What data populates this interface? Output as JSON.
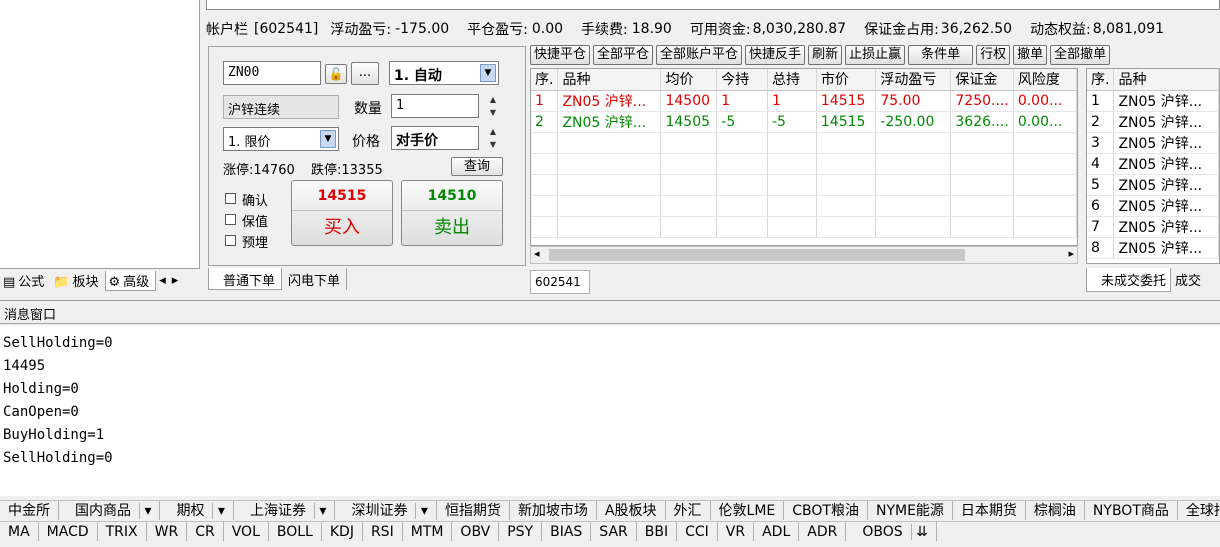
{
  "left_tabs": [
    "公式",
    "板块",
    "高级"
  ],
  "account_bar": {
    "label": "帐户栏",
    "account": "[602541]",
    "floating_pl_label": "浮动盈亏:",
    "floating_pl": "-175.00",
    "close_pl_label": "平仓盈亏:",
    "close_pl": "0.00",
    "fee_label": "手续费:",
    "fee": "18.90",
    "available_label": "可用资金:",
    "available": "8,030,280.87",
    "margin_label": "保证金占用:",
    "margin": "36,262.50",
    "equity_label": "动态权益:",
    "equity": "8,081,091"
  },
  "order_panel": {
    "contract": "ZN00",
    "more_btn": "...",
    "open_mode": "1. 自动",
    "contract_name": "沪锌连续",
    "qty_label": "数量",
    "qty": "1",
    "price_type": "1. 限价",
    "price_label": "价格",
    "price": "对手价",
    "limit_up": "涨停:14760",
    "limit_down": "跌停:13355",
    "query_btn": "查询",
    "confirm_label": "确认",
    "hold_label": "保值",
    "preset_label": "预埋",
    "buy_price": "14515",
    "buy_label": "买入",
    "sell_price": "14510",
    "sell_label": "卖出",
    "tabs": [
      "普通下单",
      "闪电下单"
    ]
  },
  "toolbar": [
    "快捷平仓",
    "全部平仓",
    "全部账户平仓",
    "快捷反手",
    "刷新",
    "止损止赢",
    "条件单",
    "行权",
    "撤单",
    "全部撤单"
  ],
  "positions": {
    "headers": [
      "序.",
      "品种",
      "均价",
      "今持",
      "总持",
      "市价",
      "浮动盈亏",
      "保证金",
      "风险度"
    ],
    "rows": [
      [
        "1",
        "ZN05 沪锌...",
        "14500",
        "1",
        "1",
        "14515",
        "75.00",
        "7250....",
        "0.00..."
      ],
      [
        "2",
        "ZN05 沪锌...",
        "14505",
        "-5",
        "-5",
        "14515",
        "-250.00",
        "3626....",
        "0.00..."
      ]
    ],
    "account_tab": "602541"
  },
  "orders_list": {
    "headers": [
      "序.",
      "品种"
    ],
    "rows": [
      "ZN05 沪锌...",
      "ZN05 沪锌...",
      "ZN05 沪锌...",
      "ZN05 沪锌...",
      "ZN05 沪锌...",
      "ZN05 沪锌...",
      "ZN05 沪锌...",
      "ZN05 沪锌..."
    ],
    "tabs": [
      "未成交委托",
      "成交"
    ]
  },
  "message_window": {
    "title": "消息窗口",
    "lines": [
      "SellHolding=0",
      "14495",
      "Holding=0",
      "CanOpen=0",
      "BuyHolding=1",
      "SellHolding=0"
    ]
  },
  "market_tabs": [
    "中金所",
    "国内商品",
    "期权",
    "上海证券",
    "深圳证券",
    "恒指期货",
    "新加坡市场",
    "A股板块",
    "外汇",
    "伦敦LME",
    "CBOT粮油",
    "NYME能源",
    "日本期货",
    "棕榈油",
    "NYBOT商品",
    "全球指"
  ],
  "indicator_tabs": [
    "MA",
    "MACD",
    "TRIX",
    "WR",
    "CR",
    "VOL",
    "BOLL",
    "KDJ",
    "RSI",
    "MTM",
    "OBV",
    "PSY",
    "BIAS",
    "SAR",
    "BBI",
    "CCI",
    "VR",
    "ADL",
    "ADR",
    "OBOS"
  ]
}
